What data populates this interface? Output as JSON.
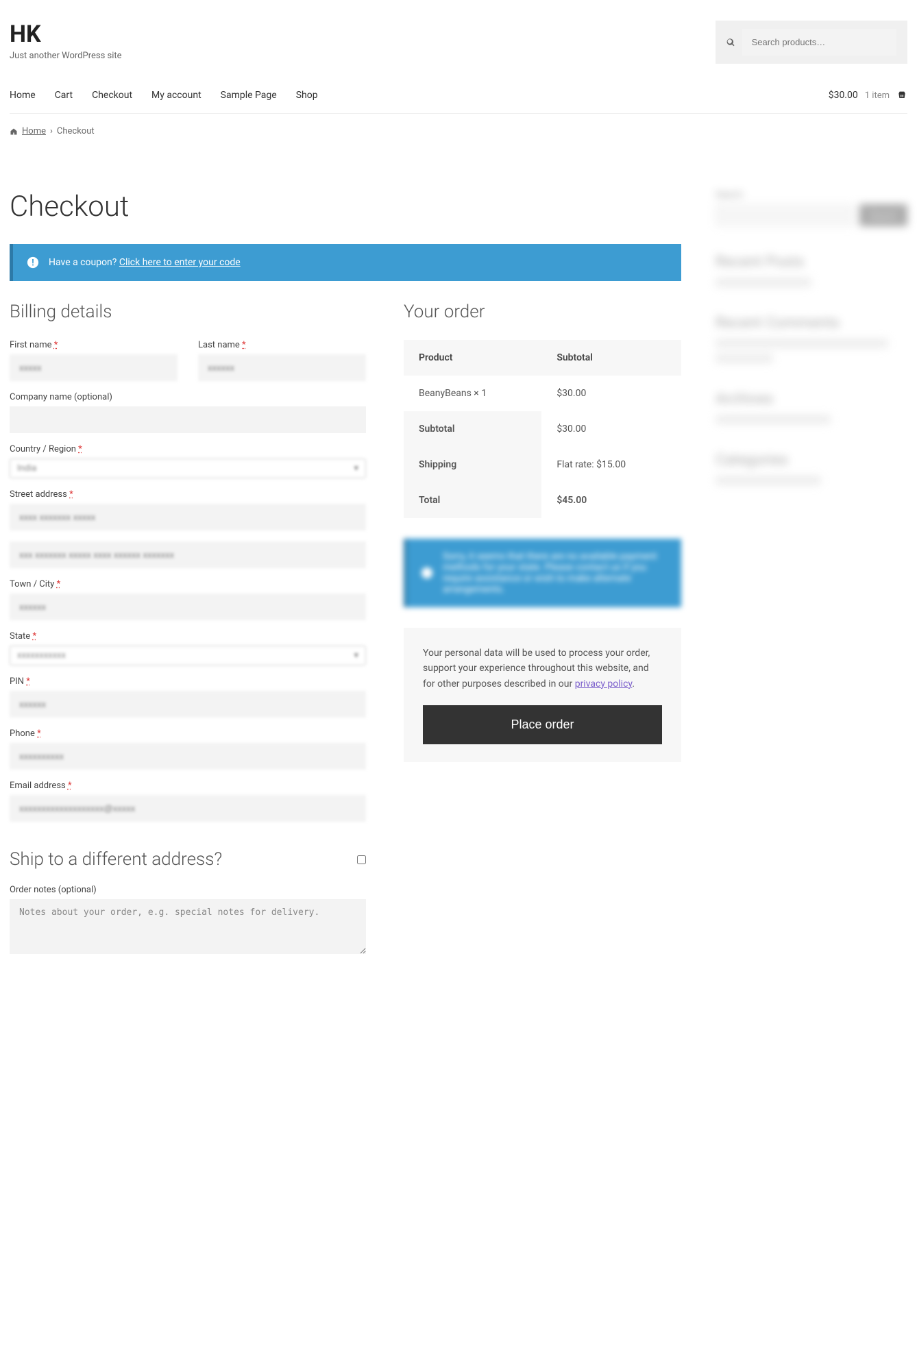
{
  "site": {
    "title": "HK",
    "tagline": "Just another WordPress site"
  },
  "search": {
    "placeholder": "Search products…"
  },
  "nav": [
    "Home",
    "Cart",
    "Checkout",
    "My account",
    "Sample Page",
    "Shop"
  ],
  "cart": {
    "total": "$30.00",
    "items": "1 item"
  },
  "breadcrumb": {
    "home": "Home",
    "current": "Checkout"
  },
  "page": {
    "title": "Checkout"
  },
  "coupon": {
    "prompt": "Have a coupon?",
    "link": "Click here to enter your code"
  },
  "billing": {
    "heading": "Billing details",
    "first_name_label": "First name",
    "last_name_label": "Last name",
    "company_label": "Company name (optional)",
    "country_label": "Country / Region",
    "street_label": "Street address",
    "street2_placeholder": "",
    "town_label": "Town / City",
    "state_label": "State",
    "pin_label": "PIN",
    "phone_label": "Phone",
    "email_label": "Email address"
  },
  "ship": {
    "heading": "Ship to a different address?",
    "notes_label": "Order notes (optional)",
    "notes_placeholder": "Notes about your order, e.g. special notes for delivery."
  },
  "order": {
    "heading": "Your order",
    "th_product": "Product",
    "th_subtotal": "Subtotal",
    "item_name": "BeanyBeans × 1",
    "item_price": "$30.00",
    "subtotal_label": "Subtotal",
    "subtotal_value": "$30.00",
    "shipping_label": "Shipping",
    "shipping_value": "Flat rate: $15.00",
    "total_label": "Total",
    "total_value": "$45.00"
  },
  "payment": {
    "privacy": "Your personal data will be used to process your order, support your experience throughout this website, and for other purposes described in our ",
    "privacy_link": "privacy policy",
    "button": "Place order"
  },
  "sidebar": {
    "search_label": "Search",
    "search_button": "Search",
    "recent_posts": "Recent Posts",
    "recent_comments": "Recent Comments",
    "archives": "Archives",
    "categories": "Categories"
  }
}
